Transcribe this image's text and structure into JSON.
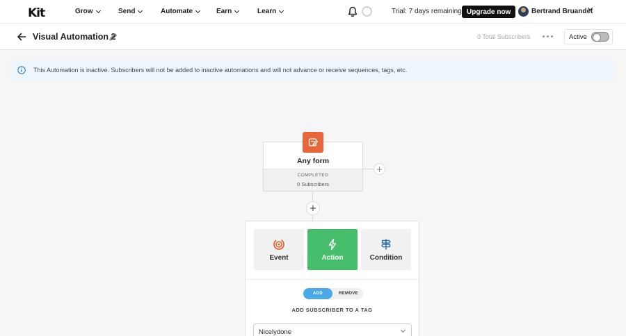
{
  "nav": {
    "logo": "Kit",
    "items": [
      {
        "label": "Grow"
      },
      {
        "label": "Send"
      },
      {
        "label": "Automate"
      },
      {
        "label": "Earn"
      },
      {
        "label": "Learn"
      }
    ],
    "trial_text": "Trial: 7 days remaining",
    "upgrade_label": "Upgrade now",
    "user_name": "Bertrand Bruandet"
  },
  "header": {
    "title": "Visual Automation 2",
    "total_subscribers": "0 Total Subscribers",
    "active_label": "Active",
    "active_on": false
  },
  "banner": {
    "text": "This Automation is inactive. Subscribers will not be added to inactive automations and will not advance or receive sequences, tags, etc."
  },
  "trigger_node": {
    "title": "Any form",
    "status": "COMPLETED",
    "count": "0 Subscribers",
    "icon": "form-icon",
    "icon_color": "#e8663a"
  },
  "step_panel": {
    "options": [
      {
        "label": "Event",
        "icon": "event-icon",
        "color": "#e8663a"
      },
      {
        "label": "Action",
        "icon": "lightning-icon",
        "selected": true,
        "color": "#45bd6a"
      },
      {
        "label": "Condition",
        "icon": "signpost-icon",
        "color": "#2f6fa8"
      }
    ],
    "segment": {
      "add": "ADD",
      "remove": "REMOVE"
    },
    "field_label": "ADD SUBSCRIBER TO A TAG",
    "select_value": "Nicelydone"
  }
}
